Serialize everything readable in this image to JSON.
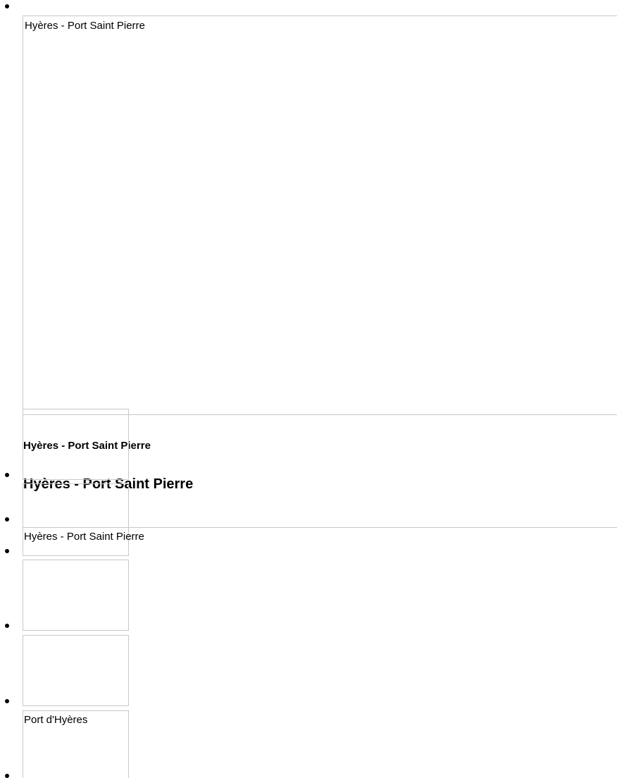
{
  "slider": {
    "slides": [
      {
        "image_alt": "Hyères - Port Saint Pierre",
        "caption_small": "Hyères - Port Saint Pierre",
        "caption_large": "Hyères - Port Saint Pierre"
      }
    ]
  },
  "thumbnails": [
    {
      "image_alt": ""
    },
    {
      "image_alt": "Hyères - Port Saint Pierre"
    },
    {
      "image_alt": ""
    },
    {
      "image_alt": ""
    },
    {
      "image_alt": "Port d'Hyères"
    }
  ],
  "colors": {
    "border": "#c8c8c8",
    "text": "#000000",
    "background": "#ffffff"
  }
}
